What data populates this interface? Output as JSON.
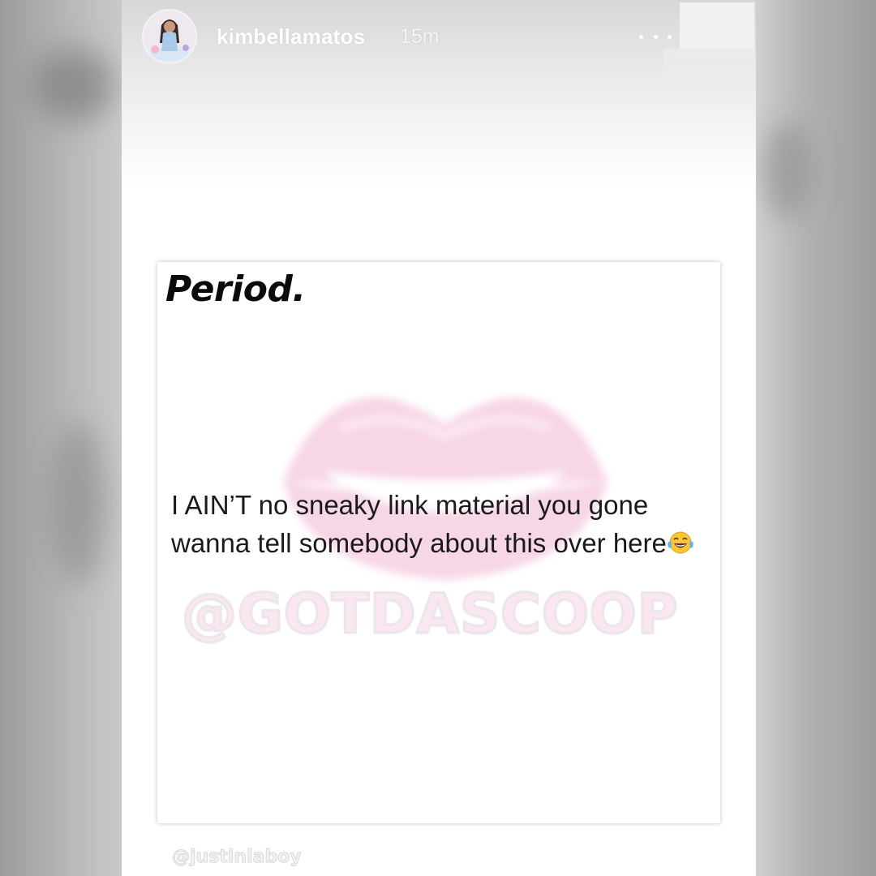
{
  "story": {
    "username": "kimbellamatos",
    "timestamp": "15m",
    "more_icon": "more-horizontal-icon"
  },
  "post": {
    "title": "Period.",
    "body": "I AIN’T no sneaky link material you gone wanna tell somebody about this over here",
    "emoji": "face-with-tears-of-joy-emoji",
    "watermark": "@GOTDASCOOP"
  },
  "credit": "@justinlaboy",
  "colors": {
    "backdrop": "#a6a6a6",
    "card": "#ffffff",
    "lips": "#f6cfe2",
    "text": "#1a1a1a"
  }
}
